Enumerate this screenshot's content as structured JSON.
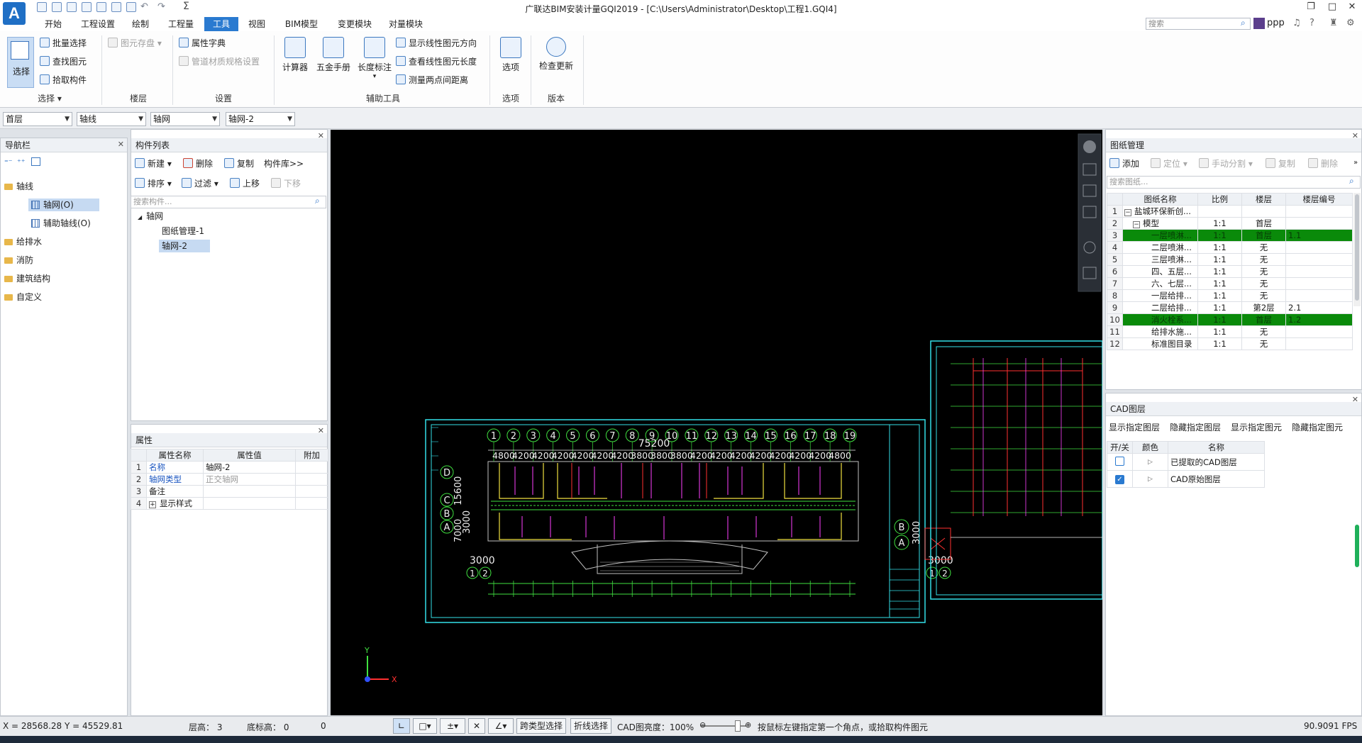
{
  "window": {
    "title": "广联达BIM安装计量GQI2019 - [C:\\Users\\Administrator\\Desktop\\工程1.GQI4]",
    "logo": "A",
    "search_placeholder": "搜索",
    "user": "ppp"
  },
  "menu": [
    "开始",
    "工程设置",
    "绘制",
    "工程量",
    "工具",
    "视图",
    "BIM模型",
    "变更模块",
    "对量模块"
  ],
  "menu_active": "工具",
  "ribbon": {
    "select": {
      "label": "选择",
      "batch": "批量选择",
      "find": "查找图元",
      "pick": "拾取构件",
      "group": "选择"
    },
    "floor": {
      "store": "图元存盘",
      "group": "楼层"
    },
    "settings": {
      "attr_dict": "属性字典",
      "pipe_spec": "管道材质规格设置",
      "group": "设置"
    },
    "tools": {
      "calc": "计算器",
      "hardware": "五金手册",
      "length_mark": "长度标注",
      "show_dir": "显示线性图元方向",
      "view_len": "查看线性图元长度",
      "measure": "测量两点间距离",
      "group": "辅助工具"
    },
    "options": {
      "label": "选项",
      "group": "选项"
    },
    "version": {
      "label": "检查更新",
      "group": "版本"
    }
  },
  "combos": [
    "首层",
    "轴线",
    "轴网",
    "轴网-2"
  ],
  "nav": {
    "title": "导航栏",
    "items": [
      "轴线",
      "轴网(O)",
      "辅助轴线(O)",
      "给排水",
      "消防",
      "建筑结构",
      "自定义"
    ]
  },
  "component_list": {
    "title": "构件列表",
    "new": "新建",
    "delete": "删除",
    "copy": "复制",
    "lib": "构件库>>",
    "sort": "排序",
    "filter": "过滤",
    "up": "上移",
    "down": "下移",
    "search_placeholder": "搜索构件...",
    "tree": [
      "轴网",
      "图纸管理-1",
      "轴网-2"
    ]
  },
  "properties": {
    "title": "属性",
    "headers": [
      "属性名称",
      "属性值",
      "附加"
    ],
    "rows": [
      {
        "n": "1",
        "name": "名称",
        "value": "轴网-2"
      },
      {
        "n": "2",
        "name": "轴网类型",
        "value": "正交轴网"
      },
      {
        "n": "3",
        "name": "备注",
        "value": ""
      },
      {
        "n": "4",
        "name": "显示样式",
        "value": ""
      }
    ]
  },
  "drawing_mgmt": {
    "title": "图纸管理",
    "add": "添加",
    "locate": "定位",
    "split": "手动分割",
    "copy": "复制",
    "delete": "删除",
    "search_placeholder": "搜索图纸...",
    "headers": [
      "图纸名称",
      "比例",
      "楼层",
      "楼层编号"
    ],
    "rows": [
      {
        "n": "1",
        "name": "盐城环保新创...",
        "scale": "",
        "floor": "",
        "code": "",
        "hl": false
      },
      {
        "n": "2",
        "name": "模型",
        "scale": "1:1",
        "floor": "首层",
        "code": "",
        "hl": false
      },
      {
        "n": "3",
        "name": "一层喷淋...",
        "scale": "1:1",
        "floor": "首层",
        "code": "1.1",
        "hl": true
      },
      {
        "n": "4",
        "name": "二层喷淋...",
        "scale": "1:1",
        "floor": "无",
        "code": "",
        "hl": false
      },
      {
        "n": "5",
        "name": "三层喷淋...",
        "scale": "1:1",
        "floor": "无",
        "code": "",
        "hl": false
      },
      {
        "n": "6",
        "name": "四、五层...",
        "scale": "1:1",
        "floor": "无",
        "code": "",
        "hl": false
      },
      {
        "n": "7",
        "name": "六、七层...",
        "scale": "1:1",
        "floor": "无",
        "code": "",
        "hl": false
      },
      {
        "n": "8",
        "name": "一层给排...",
        "scale": "1:1",
        "floor": "无",
        "code": "",
        "hl": false
      },
      {
        "n": "9",
        "name": "二层给排...",
        "scale": "1:1",
        "floor": "第2层",
        "code": "2.1",
        "hl": false
      },
      {
        "n": "10",
        "name": "消火栓系...",
        "scale": "1:1",
        "floor": "首层",
        "code": "1.2",
        "hl": true
      },
      {
        "n": "11",
        "name": "给排水施...",
        "scale": "1:1",
        "floor": "无",
        "code": "",
        "hl": false
      },
      {
        "n": "12",
        "name": "标准图目录",
        "scale": "1:1",
        "floor": "无",
        "code": "",
        "hl": false
      }
    ]
  },
  "cad_layers": {
    "title": "CAD图层",
    "actions": [
      "显示指定图层",
      "隐藏指定图层",
      "显示指定图元",
      "隐藏指定图元"
    ],
    "headers": [
      "开/关",
      "颜色",
      "名称"
    ],
    "rows": [
      {
        "name": "已提取的CAD图层",
        "on": false
      },
      {
        "name": "CAD原始图层",
        "on": true
      }
    ]
  },
  "drawing": {
    "axis_numbers": [
      "1",
      "2",
      "3",
      "4",
      "5",
      "6",
      "7",
      "8",
      "9",
      "10",
      "11",
      "12",
      "13",
      "14",
      "15",
      "16",
      "17",
      "18",
      "19"
    ],
    "total_dim": "75200",
    "dims": [
      "4800",
      "4200",
      "4200",
      "4200",
      "4200",
      "4200",
      "4200",
      "3800",
      "3800",
      "3800",
      "4200",
      "4200",
      "4200",
      "4200",
      "4200",
      "4200",
      "4200",
      "4800"
    ],
    "row_letters": [
      "D",
      "C",
      "B",
      "A"
    ],
    "left_dim": "3000",
    "left_dim2": "7000",
    "left_dim3": "15600",
    "bottom_dim": "3000",
    "bottom_axes": [
      "1",
      "2"
    ],
    "right_letters": [
      "B",
      "A"
    ],
    "right_dim": "3000",
    "right_dim2": "3000",
    "right_axes": [
      "1",
      "2"
    ],
    "ucs_x": "X",
    "ucs_y": "Y"
  },
  "status": {
    "coords": "X = 28568.28 Y = 45529.81",
    "floor_height": "层高：  3",
    "base_height": "底标高：  0",
    "zero": "0",
    "cross_select": "跨类型选择",
    "polyline_select": "折线选择",
    "cad_brightness": "CAD图亮度：100%",
    "hint": "按鼠标左键指定第一个角点，或拾取构件图元",
    "fps": "90.9091 FPS"
  },
  "colors": {
    "accent": "#2a7ad0",
    "highlight_row": "#0a8a0a",
    "cad_cyan": "#33e0e8",
    "cad_yellow": "#f0e040",
    "cad_magenta": "#ff40ff",
    "cad_green": "#40e040"
  }
}
